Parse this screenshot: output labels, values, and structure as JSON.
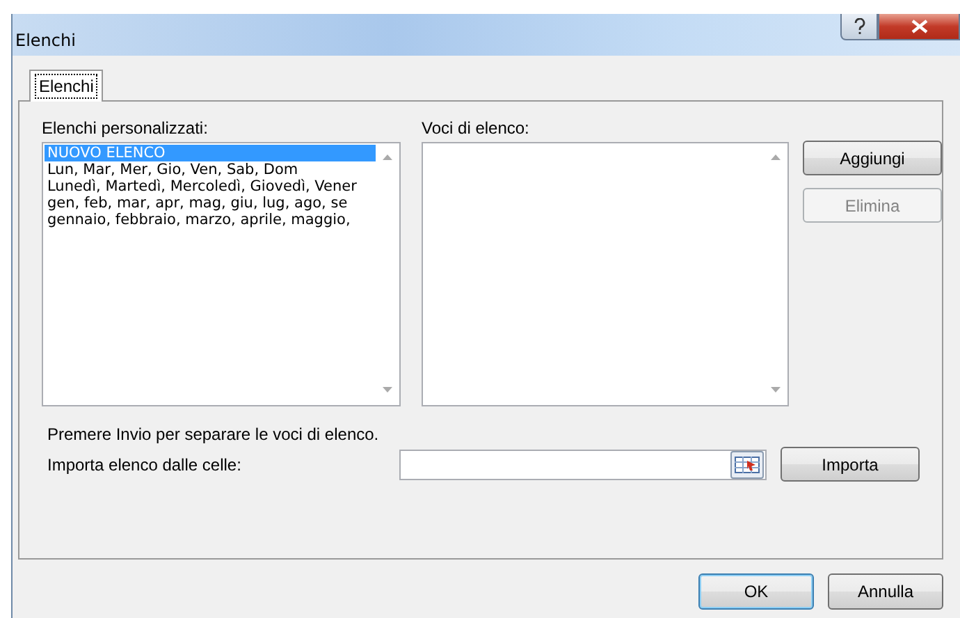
{
  "window": {
    "title": "Elenchi"
  },
  "tabs": [
    {
      "label": "Elenchi",
      "selected": true
    }
  ],
  "custom_lists": {
    "label": "Elenchi personalizzati:",
    "items": [
      {
        "text": "NUOVO ELENCO",
        "selected": true
      },
      {
        "text": "Lun, Mar, Mer, Gio, Ven, Sab, Dom",
        "selected": false
      },
      {
        "text": "Lunedì, Martedì, Mercoledì, Giovedì, Vener",
        "selected": false
      },
      {
        "text": "gen, feb, mar, apr, mag, giu, lug, ago, se",
        "selected": false
      },
      {
        "text": "gennaio, febbraio, marzo, aprile, maggio,",
        "selected": false
      }
    ]
  },
  "list_entries": {
    "label": "Voci di elenco:"
  },
  "side_buttons": [
    {
      "label": "Aggiungi",
      "disabled": false
    },
    {
      "label": "Elimina",
      "disabled": true
    }
  ],
  "hint": "Premere Invio per separare le voci di elenco.",
  "import": {
    "label": "Importa elenco dalle celle:",
    "button": "Importa"
  },
  "dialog_buttons": [
    {
      "label": "OK",
      "default": true
    },
    {
      "label": "Annulla",
      "default": false
    }
  ]
}
